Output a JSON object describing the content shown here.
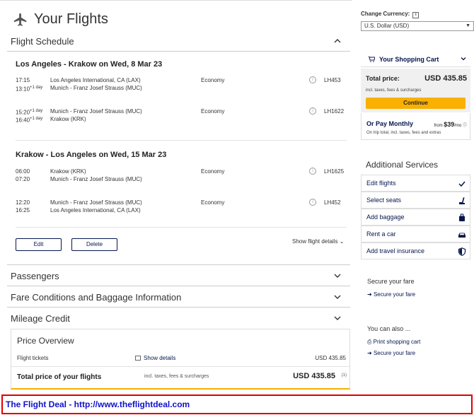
{
  "header": {
    "title": "Your Flights"
  },
  "sections": {
    "flight_schedule": "Flight Schedule",
    "passengers": "Passengers",
    "fare_conditions": "Fare Conditions and Baggage Information",
    "mileage_credit": "Mileage Credit"
  },
  "outbound": {
    "title": "Los Angeles - Krakow on Wed, 8 Mar 23",
    "legs": [
      {
        "dep_time": "17:15",
        "arr_time": "13:10",
        "arr_note": "+1 day",
        "from": "Los Angeles International, CA (LAX)",
        "to": "Munich - Franz Josef Strauss (MUC)",
        "cabin": "Economy",
        "flight": "LH453"
      },
      {
        "dep_time": "15:20",
        "dep_note": "+1 day",
        "arr_time": "16:40",
        "arr_note": "+1 day",
        "from": "Munich - Franz Josef Strauss (MUC)",
        "to": "Krakow (KRK)",
        "cabin": "Economy",
        "flight": "LH1622"
      }
    ]
  },
  "inbound": {
    "title": "Krakow - Los Angeles on Wed, 15 Mar 23",
    "legs": [
      {
        "dep_time": "06:00",
        "arr_time": "07:20",
        "from": "Krakow (KRK)",
        "to": "Munich - Franz Josef Strauss (MUC)",
        "cabin": "Economy",
        "flight": "LH1625"
      },
      {
        "dep_time": "12:20",
        "arr_time": "16:25",
        "from": "Munich - Franz Josef Strauss (MUC)",
        "to": "Los Angeles International, CA (LAX)",
        "cabin": "Economy",
        "flight": "LH452"
      }
    ]
  },
  "actions": {
    "edit": "Edit",
    "delete": "Delete",
    "show_details": "Show flight details"
  },
  "price_overview": {
    "title": "Price Overview",
    "flight_tickets_label": "Flight tickets",
    "show_details": "Show details",
    "flight_tickets_value": "USD 435.85",
    "total_label": "Total price of your flights",
    "total_sub": "incl. taxes, fees & surcharges",
    "total_value": "USD 435.85",
    "total_note": "(1)"
  },
  "sidebar": {
    "currency_label": "Change Currency:",
    "currency_value": "U.S. Dollar (USD)",
    "cart_title": "Your Shopping Cart",
    "total_label": "Total price:",
    "total_value": "USD 435.85",
    "total_sub": "incl. taxes, fees & surcharges",
    "continue": "Continue",
    "monthly_label": "Or Pay Monthly",
    "monthly_from": "from",
    "monthly_value": "$39",
    "monthly_unit": "/mo",
    "monthly_sub": "On trip total, incl. taxes, fees and extras",
    "additional_title": "Additional Services",
    "services": [
      {
        "label": "Edit flights",
        "icon": "check-icon"
      },
      {
        "label": "Select seats",
        "icon": "seat-icon"
      },
      {
        "label": "Add baggage",
        "icon": "baggage-icon"
      },
      {
        "label": "Rent a car",
        "icon": "car-icon"
      },
      {
        "label": "Add travel insurance",
        "icon": "shield-icon"
      }
    ],
    "secure_title": "Secure your fare",
    "secure_link": "Secure your fare",
    "also_title": "You can also ...",
    "print_link": "Print shopping cart",
    "secure_link2": "Secure your fare"
  },
  "footer": {
    "text": "The Flight Deal - http://www.theflightdeal.com"
  },
  "colors": {
    "accent": "#f9b000",
    "brand": "#05164d",
    "footer_border": "#e00000",
    "footer_text": "#1111cc"
  }
}
